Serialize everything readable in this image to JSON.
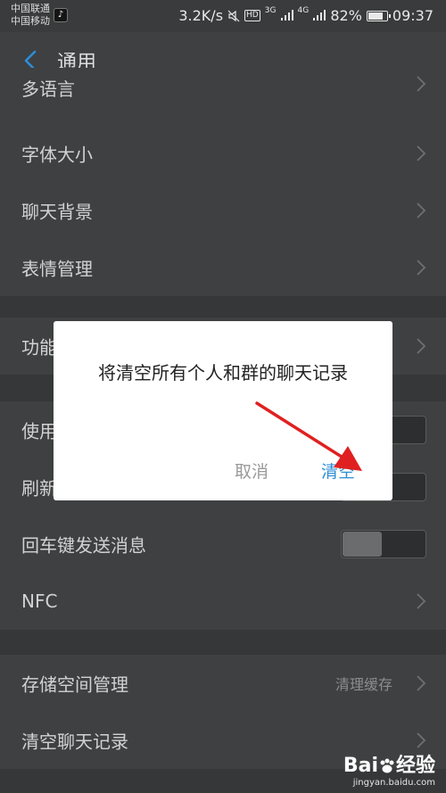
{
  "status_bar": {
    "carrier_1": "中国联通",
    "carrier_2": "中国移动",
    "net_speed": "3.2K/s",
    "hd": "HD",
    "net_3g": "3G",
    "net_4g": "4G",
    "battery": "82%",
    "battery_level": 0.82,
    "time": "09:37"
  },
  "header": {
    "title": "通用"
  },
  "rows": [
    {
      "label": "多语言"
    },
    {
      "label": "字体大小"
    },
    {
      "label": "聊天背景"
    },
    {
      "label": "表情管理"
    },
    {
      "label": "功能"
    },
    {
      "label": "使用"
    },
    {
      "label": "刷新"
    },
    {
      "label": "回车键发送消息"
    },
    {
      "label": "NFC"
    },
    {
      "label": "存储空间管理",
      "value": "清理缓存"
    },
    {
      "label": "清空聊天记录"
    }
  ],
  "dialog": {
    "message": "将清空所有个人和群的聊天记录",
    "cancel_label": "取消",
    "confirm_label": "清空"
  },
  "watermark": {
    "logo_a": "Bai",
    "logo_b": "经验",
    "url": "jingyan.baidu.com"
  },
  "colors": {
    "accent": "#2c8ed6",
    "arrow": "#e02020"
  }
}
